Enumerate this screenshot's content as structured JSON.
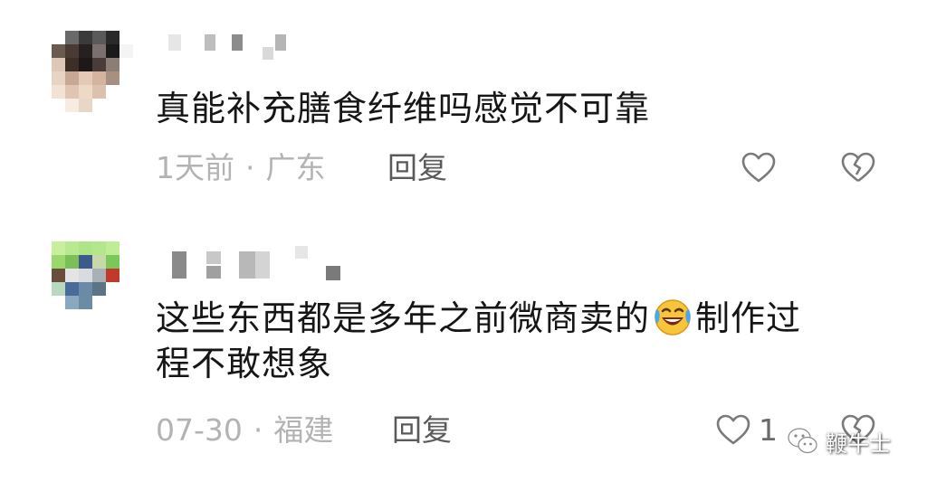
{
  "comments": [
    {
      "text": "真能补充膳食纤维吗感觉不可靠",
      "time": "1天前",
      "separator": "·",
      "location": "广东",
      "reply_label": "回复",
      "like_count": ""
    },
    {
      "text_before": "这些东西都是多年之前微商卖的",
      "text_after": "制作过\n程不敢想象",
      "emoji": "laughing-tears-emoji",
      "time": "07-30",
      "separator": "·",
      "location": "福建",
      "reply_label": "回复",
      "like_count": "1"
    }
  ],
  "watermark": {
    "label": "鞭牛士",
    "icon": "wechat-icon"
  },
  "colors": {
    "text": "#161616",
    "meta": "#b3b3b3",
    "reply": "#5a5a5a",
    "icon": "#7a7a7a",
    "emoji_face": "#f7c43a",
    "emoji_tear": "#4aa8e8"
  }
}
